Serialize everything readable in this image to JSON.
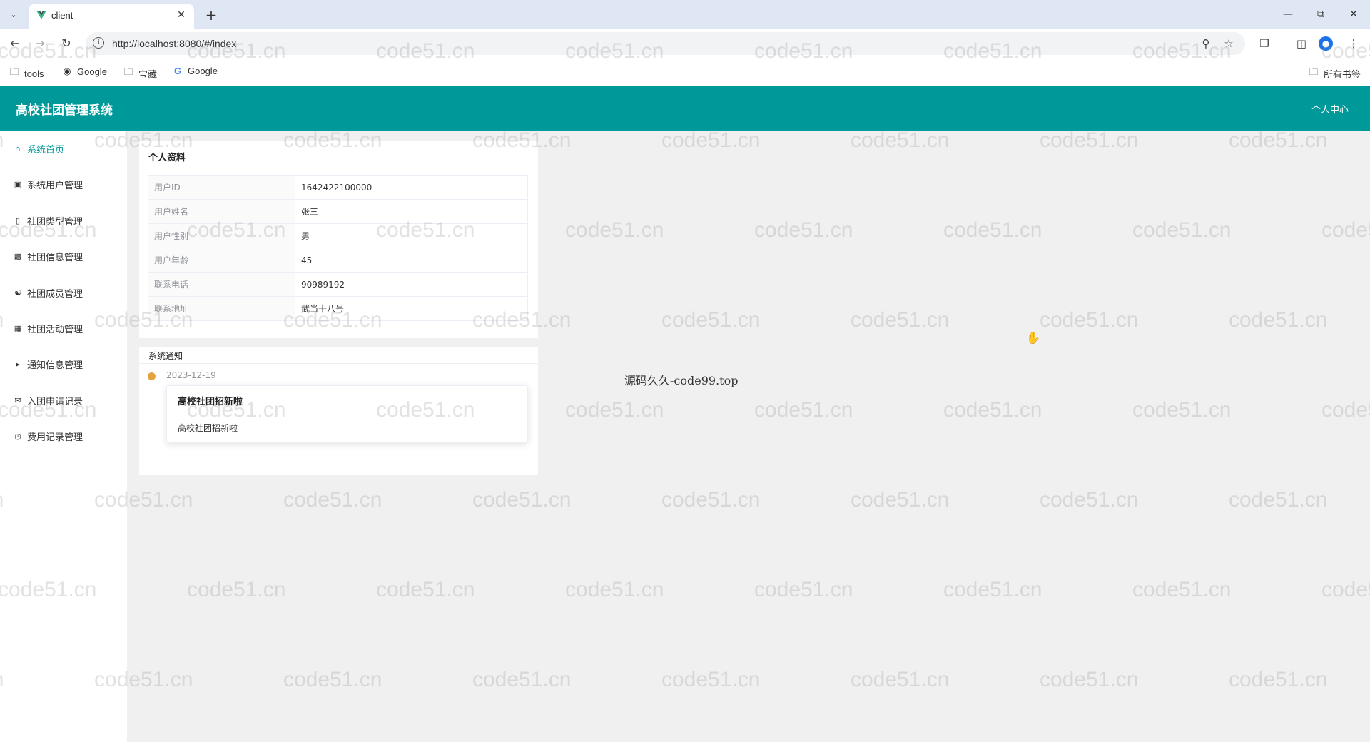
{
  "browser": {
    "tab_title": "client",
    "url": "http://localhost:8080/#/index",
    "bookmarks": [
      {
        "label": "tools",
        "icon": "folder-icon"
      },
      {
        "label": "Google",
        "icon": "globe-icon"
      },
      {
        "label": "宝藏",
        "icon": "folder-icon"
      },
      {
        "label": "Google",
        "icon": "google-icon"
      }
    ],
    "all_bookmarks": "所有书签"
  },
  "header": {
    "title": "高校社团管理系统",
    "user_center": "个人中心",
    "color": "#00999a"
  },
  "sidebar": {
    "items": [
      {
        "label": "系统首页",
        "icon": "home-icon",
        "active": true
      },
      {
        "label": "系统用户管理",
        "icon": "user-card-icon"
      },
      {
        "label": "社团类型管理",
        "icon": "document-icon"
      },
      {
        "label": "社团信息管理",
        "icon": "bus-icon"
      },
      {
        "label": "社团成员管理",
        "icon": "group-icon"
      },
      {
        "label": "社团活动管理",
        "icon": "calendar-icon"
      },
      {
        "label": "通知信息管理",
        "icon": "megaphone-icon"
      },
      {
        "label": "入团申请记录",
        "icon": "mail-icon"
      },
      {
        "label": "费用记录管理",
        "icon": "clock-icon"
      }
    ]
  },
  "profile": {
    "title": "个人资料",
    "rows": [
      {
        "label": "用户ID",
        "value": "1642422100000"
      },
      {
        "label": "用户姓名",
        "value": "张三"
      },
      {
        "label": "用户性别",
        "value": "男"
      },
      {
        "label": "用户年龄",
        "value": "45"
      },
      {
        "label": "联系电话",
        "value": "90989192"
      },
      {
        "label": "联系地址",
        "value": "武当十八号"
      }
    ]
  },
  "notices": {
    "title": "系统通知",
    "items": [
      {
        "date": "2023-12-19",
        "title": "高校社团招新啦",
        "body": "高校社团招新啦"
      }
    ]
  },
  "center_text": "源码久久-code99.top",
  "watermark_text": "code51.cn"
}
